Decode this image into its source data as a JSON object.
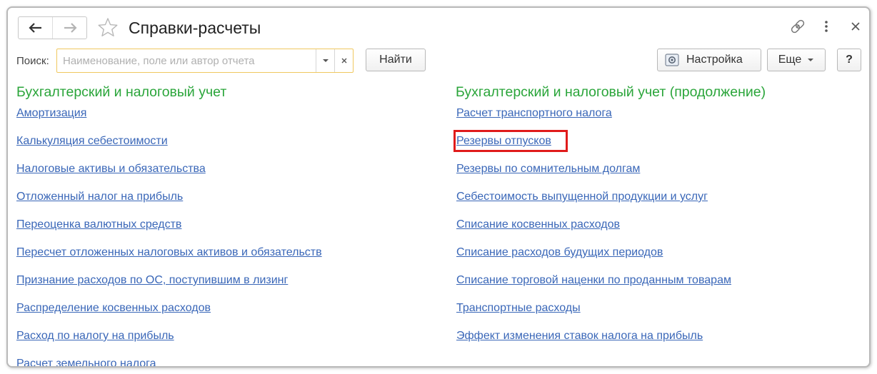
{
  "header": {
    "title": "Справки-расчеты",
    "back_icon": "arrow-left",
    "forward_icon": "arrow-right",
    "favorite_icon": "star-outline",
    "link_icon": "chain-link",
    "more_icon": "vertical-dots",
    "close_icon": "close-x"
  },
  "search": {
    "label": "Поиск:",
    "placeholder": "Наименование, поле или автор отчета",
    "value": "",
    "find_button": "Найти"
  },
  "toolbar": {
    "settings_button": "Настройка",
    "more_button": "Еще",
    "help_button": "?"
  },
  "left_column": {
    "title": "Бухгалтерский и налоговый учет",
    "links": [
      "Амортизация",
      "Калькуляция себестоимости",
      "Налоговые активы и обязательства",
      "Отложенный налог на прибыль",
      "Переоценка валютных средств",
      "Пересчет отложенных налоговых активов и обязательств",
      "Признание расходов по ОС, поступившим в лизинг",
      "Распределение косвенных расходов",
      "Расход по налогу на прибыль",
      "Расчет земельного налога"
    ]
  },
  "right_column": {
    "title": "Бухгалтерский и налоговый учет (продолжение)",
    "links": [
      "Расчет транспортного налога",
      "Резервы отпусков",
      "Резервы по сомнительным долгам",
      "Себестоимость выпущенной продукции и услуг",
      "Списание косвенных расходов",
      "Списание расходов будущих периодов",
      "Списание торговой наценки по проданным товарам",
      "Транспортные расходы",
      "Эффект изменения ставок налога на прибыль"
    ],
    "highlighted_index": 1
  },
  "colors": {
    "section_title": "#2aa53a",
    "link": "#3a67b8",
    "highlight_border": "#e01b1b",
    "search_border": "#f0c860"
  }
}
